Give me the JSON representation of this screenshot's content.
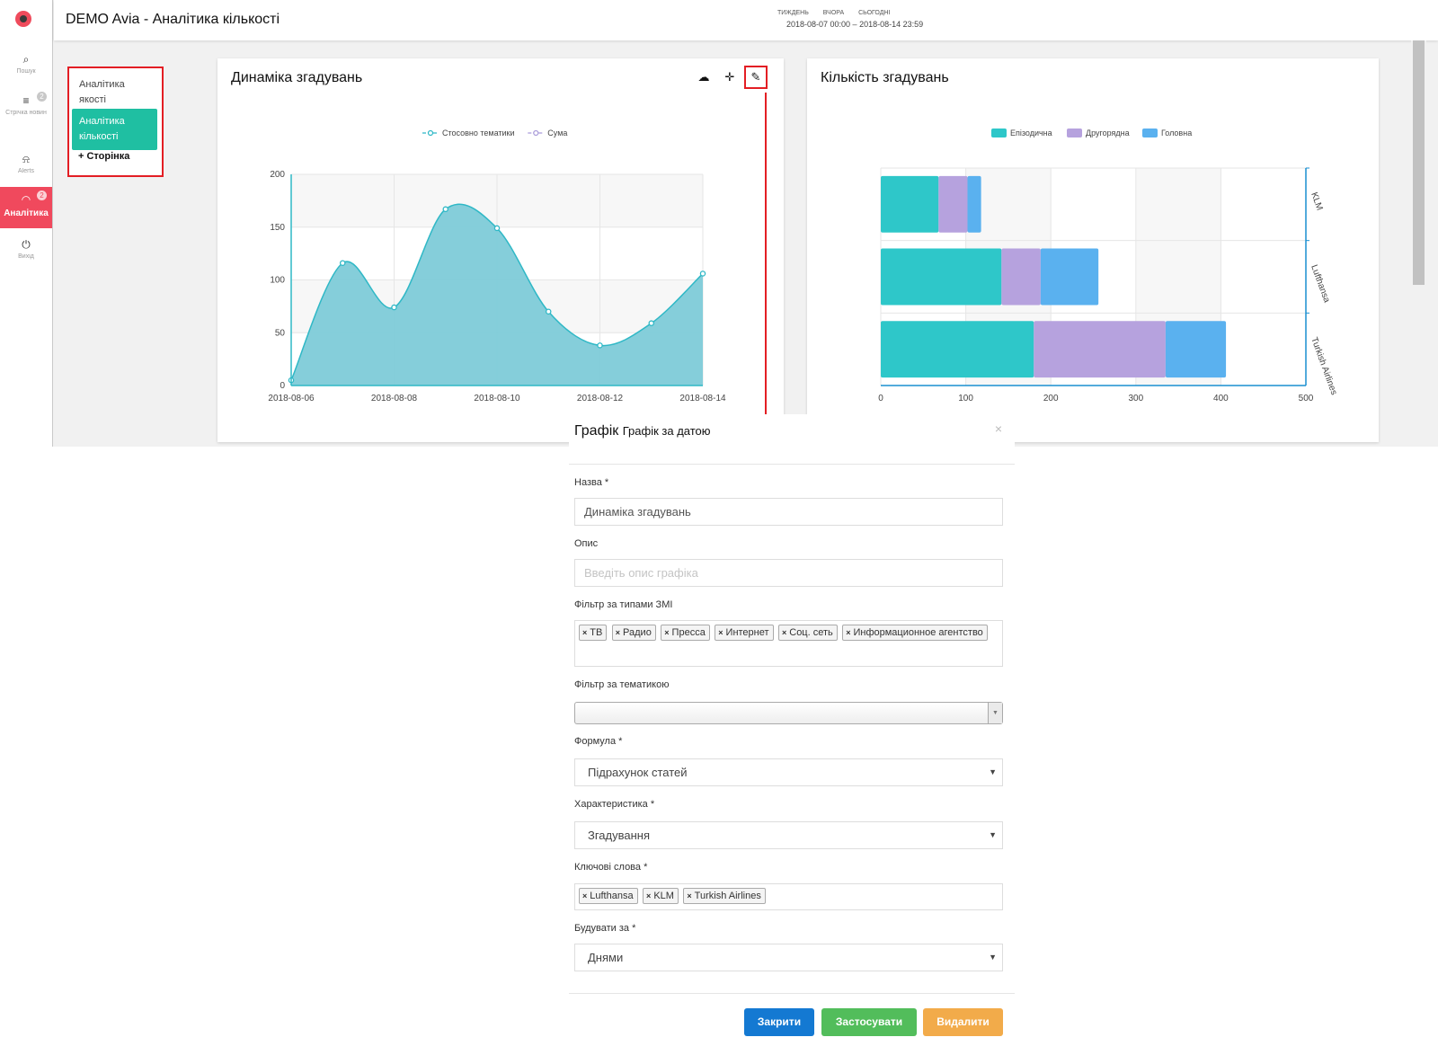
{
  "header": {
    "title": "DEMO Avia - Аналітика кількості",
    "quick_ranges": [
      "ТИЖДЕНЬ",
      "ВЧОРА",
      "СЬОГОДНІ"
    ],
    "date_range": "2018-08-07 00:00 – 2018-08-14 23:59"
  },
  "rail": {
    "items": [
      {
        "icon": "search-icon",
        "label": "Пошук",
        "badge": ""
      },
      {
        "icon": "list-icon",
        "label": "Стрічка новин",
        "badge": "2"
      },
      {
        "icon": "bell-icon",
        "label": "Alerts",
        "badge": ""
      },
      {
        "icon": "gauge-icon",
        "label": "Аналітика",
        "badge": "2"
      },
      {
        "icon": "power-icon",
        "label": "Вихід",
        "badge": ""
      }
    ]
  },
  "pagenav": {
    "items": [
      "Аналітика якості",
      "Аналітика кількості"
    ],
    "add_label": "+ Сторінка"
  },
  "cards": {
    "left": {
      "title": "Динаміка згадувань"
    },
    "right": {
      "title": "Кількість згадувань"
    }
  },
  "chart_data": [
    {
      "type": "area",
      "title": "Динаміка згадувань",
      "legend": [
        "Стосовно тематики",
        "Сума"
      ],
      "legend_position": "top",
      "x": [
        "2018-08-06",
        "2018-08-07",
        "2018-08-08",
        "2018-08-09",
        "2018-08-10",
        "2018-08-11",
        "2018-08-12",
        "2018-08-13",
        "2018-08-14"
      ],
      "x_ticks": [
        "2018-08-06",
        "2018-08-08",
        "2018-08-10",
        "2018-08-12",
        "2018-08-14"
      ],
      "series": [
        {
          "name": "Стосовно тематики",
          "values": [
            5,
            116,
            74,
            167,
            149,
            70,
            38,
            59,
            106
          ]
        }
      ],
      "ylim": [
        0,
        200
      ],
      "y_ticks": [
        0,
        50,
        100,
        150,
        200
      ],
      "grid": true,
      "colors": {
        "line": "#2fb8c6",
        "fill": "#7ecbd8"
      }
    },
    {
      "type": "bar",
      "orientation": "horizontal",
      "stacked": true,
      "title": "Кількість згадувань",
      "legend": [
        "Епізодична",
        "Другорядна",
        "Головна"
      ],
      "legend_position": "top",
      "categories": [
        "KLM",
        "Lufthansa",
        "Turkish Airlines"
      ],
      "series": [
        {
          "name": "Епізодична",
          "values": [
            68,
            142,
            180
          ],
          "color": "#2ec7c9"
        },
        {
          "name": "Другорядна",
          "values": [
            34,
            46,
            155
          ],
          "color": "#b6a2de"
        },
        {
          "name": "Головна",
          "values": [
            16,
            68,
            71
          ],
          "color": "#5ab1ef"
        }
      ],
      "xlim": [
        0,
        500
      ],
      "x_ticks": [
        0,
        100,
        200,
        300,
        400,
        500
      ],
      "grid": true
    }
  ],
  "modal": {
    "title": "Графік",
    "subtitle": "Графік за датою",
    "close_icon": "×",
    "fields": {
      "name": {
        "label": "Назва *",
        "value": "Динаміка згадувань"
      },
      "description": {
        "label": "Опис",
        "placeholder": "Введіть опис графіка"
      },
      "media_filter": {
        "label": "Фільтр за типами ЗМІ",
        "tags": [
          "ТВ",
          "Радио",
          "Пресса",
          "Интернет",
          "Соц. сеть",
          "Информационное агентство"
        ]
      },
      "topic_filter": {
        "label": "Фільтр за тематикою",
        "value": ""
      },
      "formula": {
        "label": "Формула *",
        "value": "Підрахунок статей"
      },
      "characteristic": {
        "label": "Характеристика *",
        "value": "Згадування"
      },
      "keywords": {
        "label": "Ключові слова *",
        "tags": [
          "Lufthansa",
          "KLM",
          "Turkish Airlines"
        ]
      },
      "build_by": {
        "label": "Будувати за *",
        "value": "Днями"
      }
    },
    "buttons": {
      "close": "Закрити",
      "apply": "Застосувати",
      "delete": "Видалити"
    },
    "colors": {
      "close": "#1479d2",
      "apply": "#52bd5b",
      "delete": "#f2ab4a"
    }
  }
}
